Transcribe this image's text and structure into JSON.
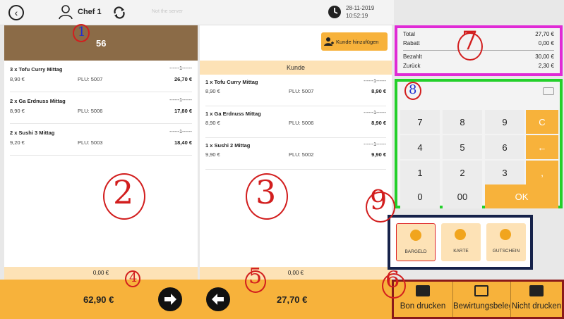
{
  "header": {
    "user_name": "Chef 1",
    "server_status": "Not the server",
    "date": "28-11-2019",
    "time": "10:52:19"
  },
  "left_panel": {
    "table_number": "56",
    "items": [
      {
        "name": "3 x Tofu Curry Mittag",
        "unit_price": "8,90 €",
        "plu": "PLU: 5007",
        "qty": "------1------",
        "total": "26,70 €"
      },
      {
        "name": "2 x Ga Erdnuss Mittag",
        "unit_price": "8,90 €",
        "plu": "PLU: 5006",
        "qty": "------1------",
        "total": "17,80 €"
      },
      {
        "name": "2 x Sushi 3 Mittag",
        "unit_price": "9,20 €",
        "plu": "PLU: 5003",
        "qty": "------1------",
        "total": "18,40 €"
      }
    ],
    "discount": "0,00 €",
    "total": "62,90 €"
  },
  "mid_panel": {
    "add_customer_label": "Kunde hinzufügen",
    "customer_header": "Kunde",
    "items": [
      {
        "name": "1 x Tofu Curry Mittag",
        "unit_price": "8,90 €",
        "plu": "PLU: 5007",
        "qty": "------1------",
        "total": "8,90 €"
      },
      {
        "name": "1 x Ga Erdnuss Mittag",
        "unit_price": "8,90 €",
        "plu": "PLU: 5006",
        "qty": "------1------",
        "total": "8,90 €"
      },
      {
        "name": "1 x Sushi 2 Mittag",
        "unit_price": "9,90 €",
        "plu": "PLU: 5002",
        "qty": "------1------",
        "total": "9,90 €"
      }
    ],
    "discount": "0,00 €",
    "total": "27,70 €"
  },
  "totals": {
    "total_label": "Total",
    "total_value": "27,70 €",
    "discount_label": "Rabatt",
    "discount_value": "0,00 €",
    "paid_label": "Bezahlt",
    "paid_value": "30,00 €",
    "change_label": "Zurück",
    "change_value": "2,30 €"
  },
  "keypad": {
    "keys": [
      "7",
      "8",
      "9",
      "C",
      "4",
      "5",
      "6",
      "←",
      "1",
      "2",
      "3",
      ",",
      "0",
      "00",
      "OK"
    ]
  },
  "payment_methods": [
    {
      "label": "BARGELD",
      "selected": true
    },
    {
      "label": "KARTE",
      "selected": false
    },
    {
      "label": "GUTSCHEIN",
      "selected": false
    }
  ],
  "print_buttons": [
    {
      "label": "Bon drucken"
    },
    {
      "label": "Bewirtungsbeleg"
    },
    {
      "label": "Nicht drucken"
    }
  ],
  "annotations": [
    "1",
    "2",
    "3",
    "4",
    "5",
    "6",
    "7",
    "8",
    "9"
  ],
  "colors": {
    "brown_header": "#8b6b47",
    "orange": "#f7b23b",
    "light_orange": "#fde2b6",
    "annotation_red": "#d21e1e",
    "annotation_blue": "#1f2fd0",
    "box_magenta": "#e02ad6",
    "box_green": "#23d02a",
    "box_navy": "#16224a",
    "box_darkred": "#8a1919"
  }
}
